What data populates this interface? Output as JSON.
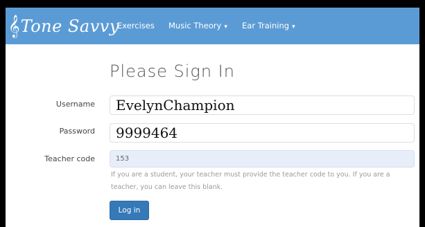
{
  "navbar": {
    "brand": "Tone Savvy",
    "brand_icon": "treble-clef-icon",
    "items": [
      {
        "label": "Exercises"
      },
      {
        "label": "Music Theory"
      },
      {
        "label": "Ear Training"
      }
    ],
    "background_color": "#5b9bd5"
  },
  "form": {
    "title": "Please Sign In",
    "username": {
      "label": "Username",
      "value": "EvelynChampion"
    },
    "password": {
      "label": "Password",
      "value": "9999464"
    },
    "teacher_code": {
      "label": "Teacher code",
      "value": "153"
    },
    "help_text": "If you are a student, your teacher must provide the teacher code to you. If you are a teacher, you can leave this blank.",
    "submit_label": "Log in",
    "button_color": "#3579b8"
  }
}
